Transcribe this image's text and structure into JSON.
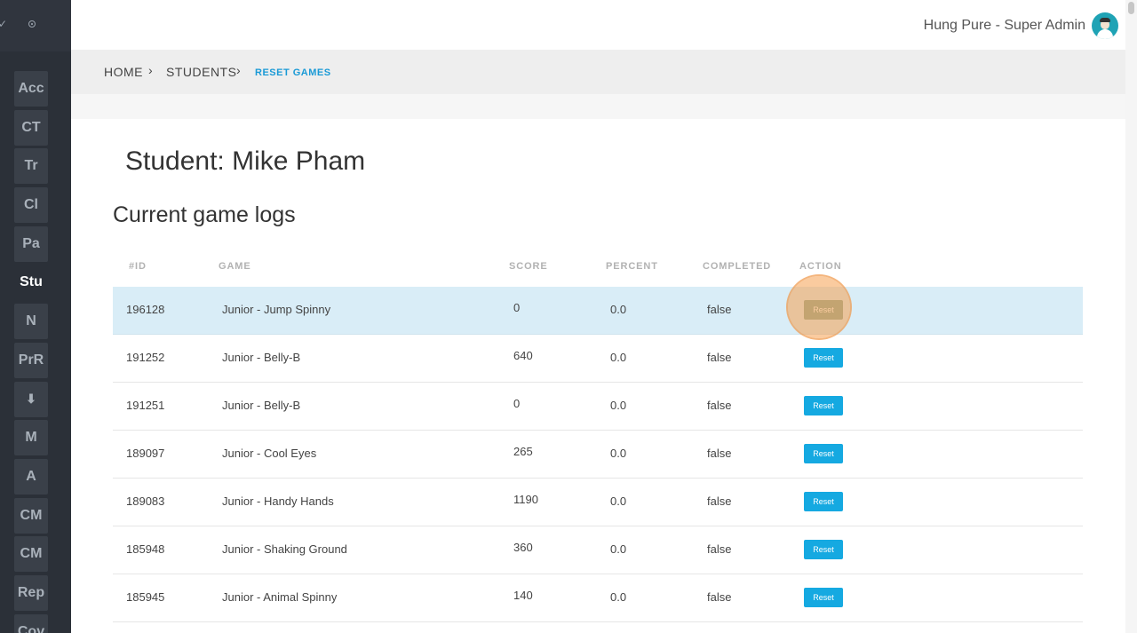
{
  "sidebar": {
    "items": [
      {
        "label": "Acc",
        "icon": null
      },
      {
        "label": "CT",
        "icon": null
      },
      {
        "label": "Tr",
        "icon": null
      },
      {
        "label": "Cl",
        "icon": null
      },
      {
        "label": "Pa",
        "icon": null
      },
      {
        "label": "Stu",
        "icon": null,
        "active": true
      },
      {
        "label": "N",
        "icon": null
      },
      {
        "label": "PrR",
        "icon": null
      },
      {
        "label": "",
        "icon": "download-icon"
      },
      {
        "label": "M",
        "icon": null
      },
      {
        "label": "A",
        "icon": null
      },
      {
        "label": "CM",
        "icon": null
      },
      {
        "label": "CM",
        "icon": null
      },
      {
        "label": "Rep",
        "icon": null
      },
      {
        "label": "Cov",
        "icon": null
      }
    ]
  },
  "header": {
    "user_name": "Hung Pure - Super Admin"
  },
  "breadcrumb": {
    "home": "HOME",
    "students": "STUDENTS",
    "current": "RESET GAMES",
    "separator": "›"
  },
  "page": {
    "student_title": "Student: Mike Pham",
    "section_title": "Current game logs"
  },
  "table": {
    "columns": [
      "#ID",
      "GAME",
      "SCORE",
      "PERCENT",
      "COMPLETED",
      "ACTION"
    ],
    "action_label": "Reset",
    "rows": [
      {
        "id": "196128",
        "game": "Junior - Jump Spinny",
        "score": "0",
        "percent": "0.0",
        "completed": "false"
      },
      {
        "id": "191252",
        "game": "Junior - Belly-B",
        "score": "640",
        "percent": "0.0",
        "completed": "false"
      },
      {
        "id": "191251",
        "game": "Junior - Belly-B",
        "score": "0",
        "percent": "0.0",
        "completed": "false"
      },
      {
        "id": "189097",
        "game": "Junior - Cool Eyes",
        "score": "265",
        "percent": "0.0",
        "completed": "false"
      },
      {
        "id": "189083",
        "game": "Junior - Handy Hands",
        "score": "1190",
        "percent": "0.0",
        "completed": "false"
      },
      {
        "id": "185948",
        "game": "Junior - Shaking Ground",
        "score": "360",
        "percent": "0.0",
        "completed": "false"
      },
      {
        "id": "185945",
        "game": "Junior - Animal Spinny",
        "score": "140",
        "percent": "0.0",
        "completed": "false"
      }
    ]
  },
  "colors": {
    "accent": "#15a9e1",
    "sidebar_bg": "#2b3038",
    "highlight_row": "#d9edf7"
  }
}
